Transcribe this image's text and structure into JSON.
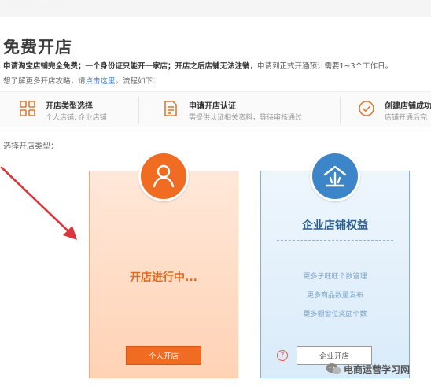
{
  "page": {
    "title": "免费开店",
    "intro_bold": "申请淘宝店铺完全免费；一个身份证只能开一家店；开店之后店铺无法注销",
    "intro_rest": "，申请到正式开通预计需要1~3个工作日。",
    "guide_prefix": "想了解更多开店攻略，请",
    "guide_link": "点击这里",
    "guide_suffix": "。流程如下："
  },
  "steps": [
    {
      "icon": "grid-icon",
      "title": "开店类型选择",
      "desc": "个人店铺, 企业店铺"
    },
    {
      "icon": "document-icon",
      "title": "申请开店认证",
      "desc": "需提供认证相关资料，等待审核通过"
    },
    {
      "icon": "check-circle-icon",
      "title": "创建店铺成功",
      "desc": "店铺开通后完"
    }
  ],
  "choose_label": "选择开店类型：",
  "personal_card": {
    "icon": "user-icon",
    "status": "开店进行中...",
    "button_label": "个人开店"
  },
  "enterprise_card": {
    "icon": "enterprise-icon",
    "title": "企业店铺权益",
    "benefits": [
      "更多子旺旺个数管理",
      "更多商品数量发布",
      "更多橱窗位奖励个数"
    ],
    "help_glyph": "?",
    "button_label": "企业开店"
  },
  "watermark": {
    "text": "电商运营学习网"
  },
  "colors": {
    "accent_orange": "#f06c22",
    "accent_blue": "#3d85c9",
    "arrow_red": "#d9363e"
  }
}
